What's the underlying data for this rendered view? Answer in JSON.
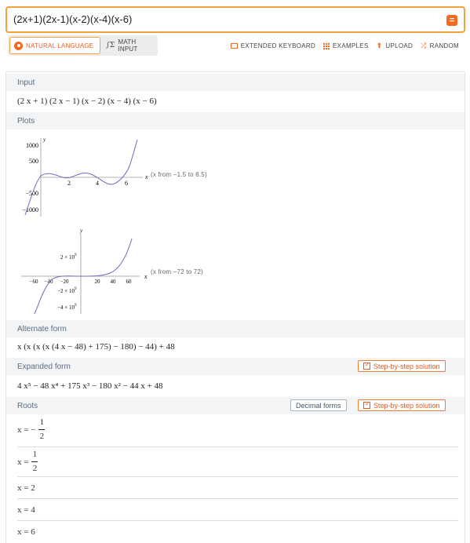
{
  "search": {
    "query": "(2x+1)(2x-1)(x-2)(x-4)(x-6)",
    "go_icon": "equals-icon"
  },
  "modes": {
    "natural": "NATURAL LANGUAGE",
    "math": "MATH INPUT"
  },
  "tools": {
    "keyboard": "EXTENDED KEYBOARD",
    "examples": "EXAMPLES",
    "upload": "UPLOAD",
    "random": "RANDOM"
  },
  "accent": "#f36a1e",
  "pods": {
    "input": {
      "title": "Input",
      "value": "(2 x + 1) (2 x − 1) (x − 2) (x − 4) (x − 6)"
    },
    "plots": {
      "title": "Plots",
      "plot1": {
        "range_note": "(x from −1.5 to 6.5)",
        "xlabel": "x",
        "ylabel": "y",
        "yticks": [
          "1000",
          "500",
          "−500",
          "−1000"
        ],
        "xticks": [
          "2",
          "4",
          "6"
        ]
      },
      "plot2": {
        "range_note": "(x from −72 to 72)",
        "xlabel": "x",
        "ylabel": "y",
        "yticks": [
          "2 × 10",
          "−2 × 10",
          "−4 × 10"
        ],
        "ytick_exp": "9",
        "xticks": [
          "−60",
          "−40",
          "−20",
          "20",
          "40",
          "60"
        ]
      }
    },
    "alternate": {
      "title": "Alternate form",
      "value": "x (x (x (x (4 x − 48) + 175) − 180) − 44) + 48"
    },
    "expanded": {
      "title": "Expanded form",
      "step_label": "Step-by-step solution",
      "value": "4 x⁵ − 48 x⁴ + 175 x³ − 180 x² − 44 x + 48"
    },
    "roots": {
      "title": "Roots",
      "decimal_label": "Decimal forms",
      "step_label": "Step-by-step solution",
      "r1_prefix": "x = −",
      "r1_num": "1",
      "r1_den": "2",
      "r2_prefix": "x =",
      "r2_num": "1",
      "r2_den": "2",
      "r3": "x = 2",
      "r4": "x = 4",
      "r5": "x = 6"
    }
  }
}
